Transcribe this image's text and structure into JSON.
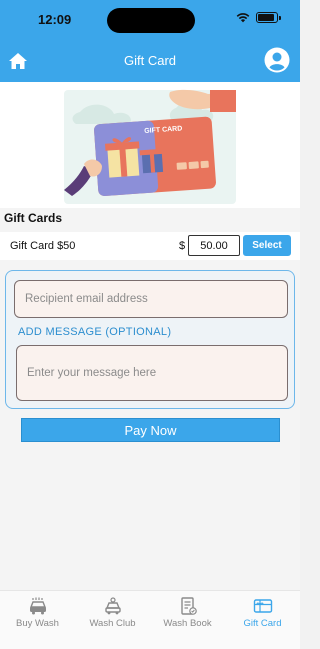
{
  "status_bar": {
    "time": "12:09"
  },
  "header": {
    "title": "Gift Card"
  },
  "hero": {
    "card_text": "GIFT CARD"
  },
  "gift_cards": {
    "section_title": "Gift Cards",
    "item": {
      "name": "Gift Card $50",
      "currency": "$",
      "amount": "50.00",
      "select_label": "Select"
    }
  },
  "form": {
    "email_placeholder": "Recipient email address",
    "add_message_label": "ADD MESSAGE (OPTIONAL)",
    "message_placeholder": "Enter your message here"
  },
  "pay_button_label": "Pay Now",
  "tabs": [
    {
      "label": "Buy Wash",
      "icon": "car-wash-icon",
      "active": false
    },
    {
      "label": "Wash Club",
      "icon": "wash-club-icon",
      "active": false
    },
    {
      "label": "Wash Book",
      "icon": "wash-book-icon",
      "active": false
    },
    {
      "label": "Gift Card",
      "icon": "gift-card-icon",
      "active": true
    }
  ],
  "colors": {
    "accent": "#3ba6ea",
    "field_bg": "#faf2ee",
    "label_blue": "#2d8ecf"
  }
}
